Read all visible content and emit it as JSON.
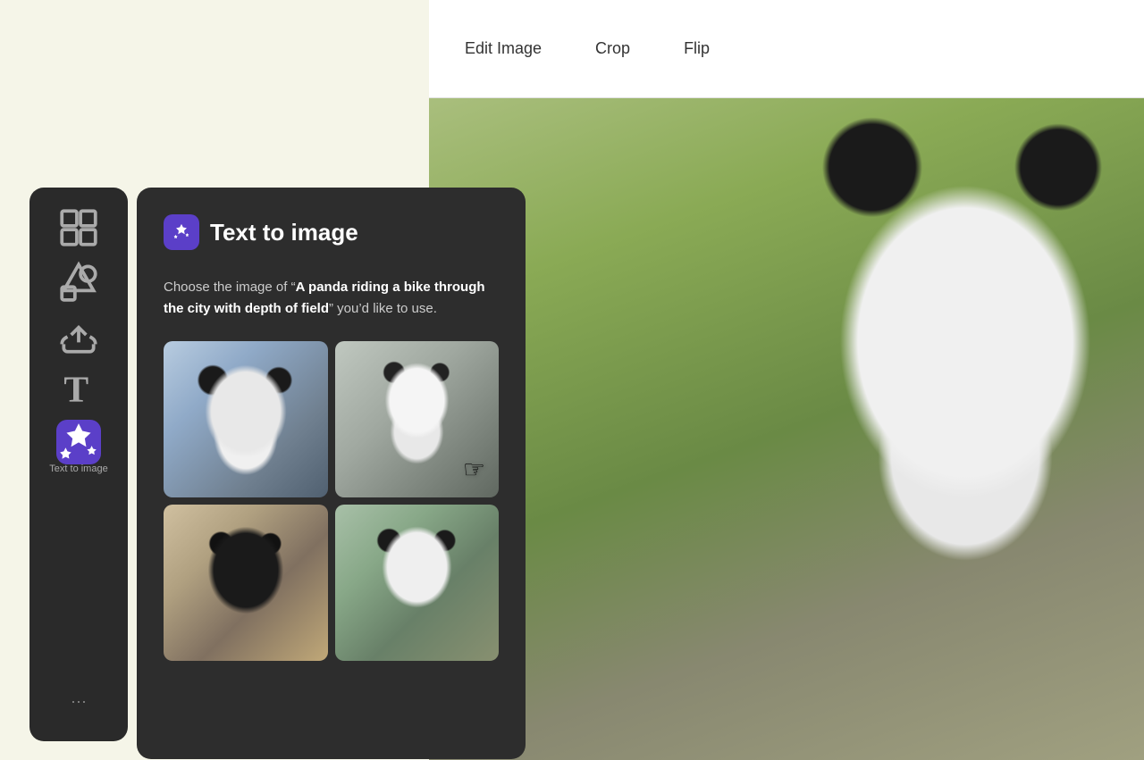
{
  "toolbar": {
    "edit_image_label": "Edit Image",
    "crop_label": "Crop",
    "flip_label": "Flip"
  },
  "sidebar": {
    "icons": [
      {
        "name": "grid-icon",
        "symbol": "⊞",
        "label": null
      },
      {
        "name": "shapes-icon",
        "symbol": "♡△◻",
        "label": null
      },
      {
        "name": "upload-icon",
        "symbol": "↑",
        "label": null
      },
      {
        "name": "text-icon",
        "symbol": "T",
        "label": null
      },
      {
        "name": "text-to-image-icon",
        "symbol": "✦",
        "label": "Text to image",
        "active": true
      }
    ],
    "more_label": "···"
  },
  "panel": {
    "title": "Text to image",
    "icon_symbol": "✦✳",
    "description_prefix": "Choose the image of “",
    "prompt": "A panda riding a bike through the city with depth of field",
    "description_suffix": "” you’d like to use.",
    "images": [
      {
        "id": "panda-1",
        "alt": "Panda riding bike street view"
      },
      {
        "id": "panda-2",
        "alt": "Panda on small bicycle"
      },
      {
        "id": "panda-3",
        "alt": "Panda riding orange bike city"
      },
      {
        "id": "panda-4",
        "alt": "Panda on bike close-up"
      }
    ]
  }
}
